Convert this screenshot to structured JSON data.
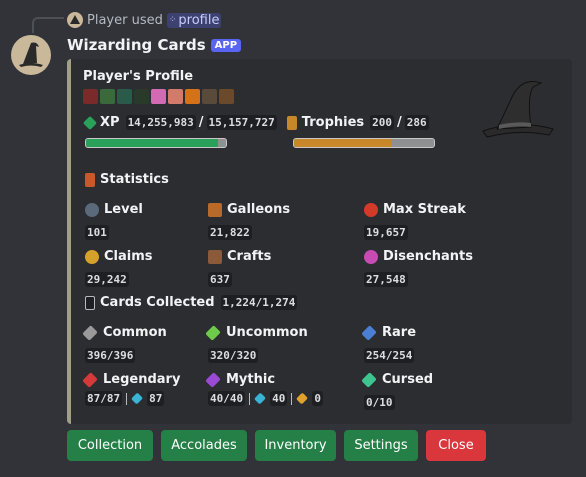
{
  "reply": {
    "user_text": "Player used",
    "command": "profile"
  },
  "author": {
    "name": "Wizarding Cards",
    "badge": "APP"
  },
  "embed": {
    "title": "Player's Profile",
    "xp": {
      "label": "XP",
      "value": "14,255,983",
      "max": "15,157,727",
      "progress": 0.94
    },
    "trophies": {
      "label": "Trophies",
      "value": "200",
      "max": "286",
      "progress": 0.7
    },
    "statistics_title": "Statistics",
    "stats": [
      {
        "label": "Level",
        "value": "101"
      },
      {
        "label": "Galleons",
        "value": "21,822"
      },
      {
        "label": "Max Streak",
        "value": "19,657"
      },
      {
        "label": "Claims",
        "value": "29,242"
      },
      {
        "label": "Crafts",
        "value": "637"
      },
      {
        "label": "Disenchants",
        "value": "27,548"
      }
    ],
    "cards_collected": {
      "label": "Cards Collected",
      "value": "1,224/1,274"
    },
    "rarities": [
      {
        "label": "Common",
        "value": "396/396",
        "color": "#9a9a9a"
      },
      {
        "label": "Uncommon",
        "value": "320/320",
        "color": "#6ecb4a"
      },
      {
        "label": "Rare",
        "value": "254/254",
        "color": "#4a7fd4"
      },
      {
        "label": "Legendary",
        "value": "87/87",
        "extra": "87",
        "color": "#d43a3a"
      },
      {
        "label": "Mythic",
        "value": "40/40",
        "extra": "40",
        "extra2": "0",
        "color": "#9a4ad4"
      },
      {
        "label": "Cursed",
        "value": "0/10",
        "color": "#3ec48f"
      }
    ]
  },
  "buttons": [
    "Collection",
    "Accolades",
    "Inventory",
    "Settings",
    "Close"
  ],
  "colors": {
    "accent": "#248046",
    "danger": "#da373c",
    "embed_border": "#a29f88",
    "xp_bar": "#2aa15a",
    "trophy_bar": "#c8882a"
  }
}
